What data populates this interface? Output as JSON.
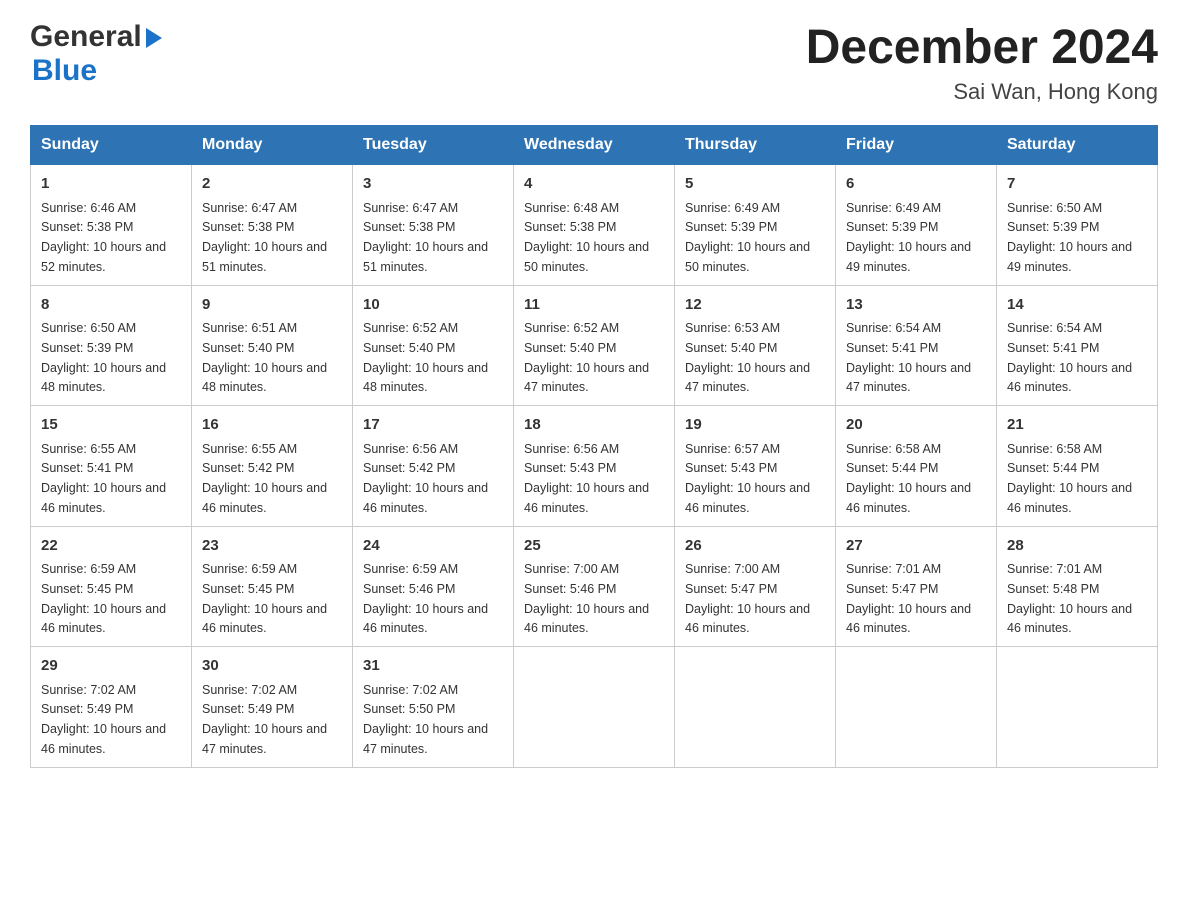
{
  "header": {
    "logo_general": "General",
    "logo_blue": "Blue",
    "month_title": "December 2024",
    "location": "Sai Wan, Hong Kong"
  },
  "days_of_week": [
    "Sunday",
    "Monday",
    "Tuesday",
    "Wednesday",
    "Thursday",
    "Friday",
    "Saturday"
  ],
  "weeks": [
    [
      {
        "day": "1",
        "sunrise": "6:46 AM",
        "sunset": "5:38 PM",
        "daylight": "10 hours and 52 minutes."
      },
      {
        "day": "2",
        "sunrise": "6:47 AM",
        "sunset": "5:38 PM",
        "daylight": "10 hours and 51 minutes."
      },
      {
        "day": "3",
        "sunrise": "6:47 AM",
        "sunset": "5:38 PM",
        "daylight": "10 hours and 51 minutes."
      },
      {
        "day": "4",
        "sunrise": "6:48 AM",
        "sunset": "5:38 PM",
        "daylight": "10 hours and 50 minutes."
      },
      {
        "day": "5",
        "sunrise": "6:49 AM",
        "sunset": "5:39 PM",
        "daylight": "10 hours and 50 minutes."
      },
      {
        "day": "6",
        "sunrise": "6:49 AM",
        "sunset": "5:39 PM",
        "daylight": "10 hours and 49 minutes."
      },
      {
        "day": "7",
        "sunrise": "6:50 AM",
        "sunset": "5:39 PM",
        "daylight": "10 hours and 49 minutes."
      }
    ],
    [
      {
        "day": "8",
        "sunrise": "6:50 AM",
        "sunset": "5:39 PM",
        "daylight": "10 hours and 48 minutes."
      },
      {
        "day": "9",
        "sunrise": "6:51 AM",
        "sunset": "5:40 PM",
        "daylight": "10 hours and 48 minutes."
      },
      {
        "day": "10",
        "sunrise": "6:52 AM",
        "sunset": "5:40 PM",
        "daylight": "10 hours and 48 minutes."
      },
      {
        "day": "11",
        "sunrise": "6:52 AM",
        "sunset": "5:40 PM",
        "daylight": "10 hours and 47 minutes."
      },
      {
        "day": "12",
        "sunrise": "6:53 AM",
        "sunset": "5:40 PM",
        "daylight": "10 hours and 47 minutes."
      },
      {
        "day": "13",
        "sunrise": "6:54 AM",
        "sunset": "5:41 PM",
        "daylight": "10 hours and 47 minutes."
      },
      {
        "day": "14",
        "sunrise": "6:54 AM",
        "sunset": "5:41 PM",
        "daylight": "10 hours and 46 minutes."
      }
    ],
    [
      {
        "day": "15",
        "sunrise": "6:55 AM",
        "sunset": "5:41 PM",
        "daylight": "10 hours and 46 minutes."
      },
      {
        "day": "16",
        "sunrise": "6:55 AM",
        "sunset": "5:42 PM",
        "daylight": "10 hours and 46 minutes."
      },
      {
        "day": "17",
        "sunrise": "6:56 AM",
        "sunset": "5:42 PM",
        "daylight": "10 hours and 46 minutes."
      },
      {
        "day": "18",
        "sunrise": "6:56 AM",
        "sunset": "5:43 PM",
        "daylight": "10 hours and 46 minutes."
      },
      {
        "day": "19",
        "sunrise": "6:57 AM",
        "sunset": "5:43 PM",
        "daylight": "10 hours and 46 minutes."
      },
      {
        "day": "20",
        "sunrise": "6:58 AM",
        "sunset": "5:44 PM",
        "daylight": "10 hours and 46 minutes."
      },
      {
        "day": "21",
        "sunrise": "6:58 AM",
        "sunset": "5:44 PM",
        "daylight": "10 hours and 46 minutes."
      }
    ],
    [
      {
        "day": "22",
        "sunrise": "6:59 AM",
        "sunset": "5:45 PM",
        "daylight": "10 hours and 46 minutes."
      },
      {
        "day": "23",
        "sunrise": "6:59 AM",
        "sunset": "5:45 PM",
        "daylight": "10 hours and 46 minutes."
      },
      {
        "day": "24",
        "sunrise": "6:59 AM",
        "sunset": "5:46 PM",
        "daylight": "10 hours and 46 minutes."
      },
      {
        "day": "25",
        "sunrise": "7:00 AM",
        "sunset": "5:46 PM",
        "daylight": "10 hours and 46 minutes."
      },
      {
        "day": "26",
        "sunrise": "7:00 AM",
        "sunset": "5:47 PM",
        "daylight": "10 hours and 46 minutes."
      },
      {
        "day": "27",
        "sunrise": "7:01 AM",
        "sunset": "5:47 PM",
        "daylight": "10 hours and 46 minutes."
      },
      {
        "day": "28",
        "sunrise": "7:01 AM",
        "sunset": "5:48 PM",
        "daylight": "10 hours and 46 minutes."
      }
    ],
    [
      {
        "day": "29",
        "sunrise": "7:02 AM",
        "sunset": "5:49 PM",
        "daylight": "10 hours and 46 minutes."
      },
      {
        "day": "30",
        "sunrise": "7:02 AM",
        "sunset": "5:49 PM",
        "daylight": "10 hours and 47 minutes."
      },
      {
        "day": "31",
        "sunrise": "7:02 AM",
        "sunset": "5:50 PM",
        "daylight": "10 hours and 47 minutes."
      },
      null,
      null,
      null,
      null
    ]
  ],
  "labels": {
    "sunrise": "Sunrise:",
    "sunset": "Sunset:",
    "daylight": "Daylight:"
  }
}
